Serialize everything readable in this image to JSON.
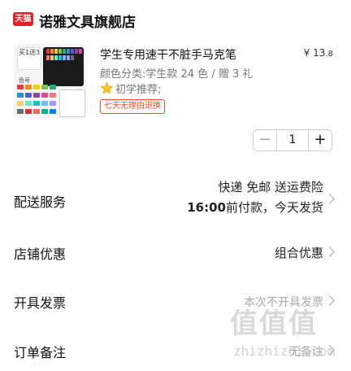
{
  "store": {
    "logo_text": "天猫",
    "name": "诺雅文具旗舰店"
  },
  "product": {
    "title": "学生专用速干不脏手马克笔",
    "price_currency": "¥",
    "price_whole": "13",
    "price_cents": ".8",
    "variant": "颜色分类:学生款 24 色 / 赠 3 礼",
    "recommend": "初学推荐;",
    "return_policy": "七天无理由退换",
    "thumbnail": {
      "badge_text": "买1送3",
      "label_text": "色号"
    }
  },
  "quantity": {
    "minus": "−",
    "value": "1",
    "plus": "+"
  },
  "delivery": {
    "label": "配送服务",
    "line1": "快递 免邮 送运费险",
    "line2_time": "16:00",
    "line2_rest": "前付款，今天发货"
  },
  "discount": {
    "label": "店铺优惠",
    "value": "组合优惠"
  },
  "invoice": {
    "label": "开具发票",
    "value": "本次不开具发票"
  },
  "remark": {
    "label": "订单备注",
    "value": "无备注"
  },
  "watermark": {
    "glyphs": "值值值",
    "text": "zhizhizhi.com"
  },
  "colors": {
    "brand_red": "#e5222b",
    "accent_orange": "#f24b2f",
    "muted_text": "#777777"
  }
}
